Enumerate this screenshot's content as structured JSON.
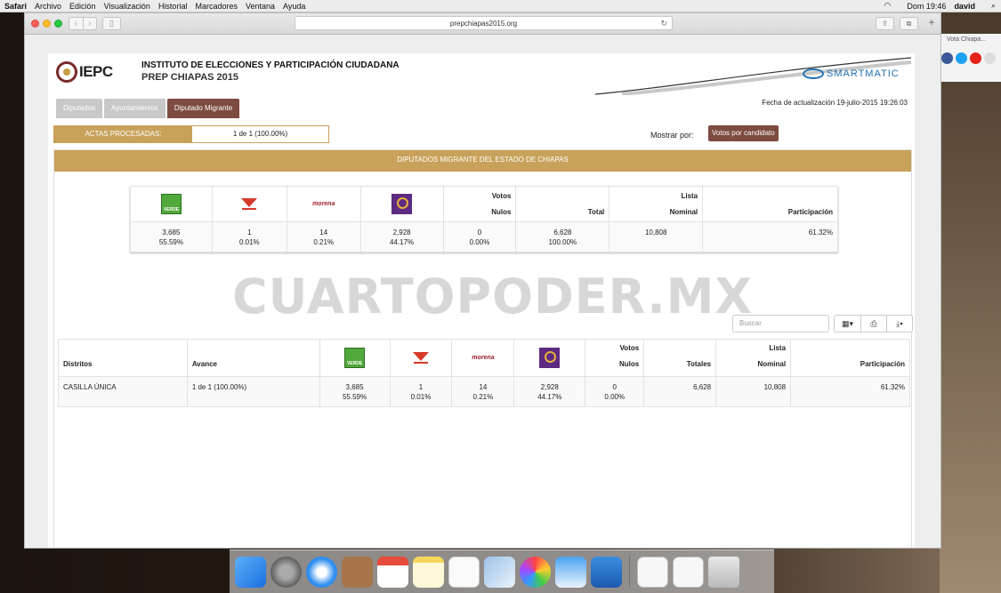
{
  "menubar": {
    "app": "Safari",
    "items": [
      "Archivo",
      "Edición",
      "Visualización",
      "Historial",
      "Marcadores",
      "Ventana",
      "Ayuda"
    ],
    "clock": "Dom 19:46",
    "user": "david"
  },
  "browser": {
    "url": "prepchiapas2015.org",
    "side_tab": "Vota Chiapa..."
  },
  "site": {
    "logo": "IEPC",
    "org": "INSTITUTO DE ELECCIONES Y PARTICIPACIÓN CIUDADANA",
    "sub": "PREP CHIAPAS 2015",
    "partner": "SMARTMATIC"
  },
  "tabs": [
    "Diputados",
    "Ayuntamientos",
    "Diputado Migrante"
  ],
  "fecha": "Fecha de actualización 19-julio-2015 19:26:03",
  "actas": {
    "label": "ACTAS PROCESADAS:",
    "value": "1 de 1 (100.00%)"
  },
  "mostrar": {
    "label": "Mostrar por:",
    "button": "Votos por candidato"
  },
  "panel_title": "DIPUTADOS MIGRANTE DEL ESTADO DE CHIAPAS",
  "parties": {
    "morena": "morena"
  },
  "summary": {
    "headers": {
      "votos_nulos_1": "Votos",
      "votos_nulos_2": "Nulos",
      "total": "Total",
      "lista_1": "Lista",
      "lista_2": "Nominal",
      "participacion": "Participación"
    },
    "row": {
      "verde": [
        "3,685",
        "55.59%"
      ],
      "pri": [
        "1",
        "0.01%"
      ],
      "morena": [
        "14",
        "0.21%"
      ],
      "mover": [
        "2,928",
        "44.17%"
      ],
      "nulos": [
        "0",
        "0.00%"
      ],
      "total": [
        "6,628",
        "100.00%"
      ],
      "lista": "10,808",
      "participacion": "61.32%"
    }
  },
  "watermark": "CUARTOPODER.MX",
  "search_placeholder": "Buscar",
  "main": {
    "headers": {
      "distritos": "Distritos",
      "avance": "Avance",
      "votos_nulos_1": "Votos",
      "votos_nulos_2": "Nulos",
      "totales": "Totales",
      "lista_1": "Lista",
      "lista_2": "Nominal",
      "participacion": "Participación"
    },
    "row": {
      "distrito": "CASILLA ÚNICA",
      "avance": "1 de 1 (100.00%)",
      "verde": [
        "3,685",
        "55.59%"
      ],
      "pri": [
        "1",
        "0.01%"
      ],
      "morena": [
        "14",
        "0.21%"
      ],
      "mover": [
        "2,928",
        "44.17%"
      ],
      "nulos": [
        "0",
        "0.00%"
      ],
      "totales": "6,628",
      "lista": "10,808",
      "participacion": "61.32%"
    }
  }
}
